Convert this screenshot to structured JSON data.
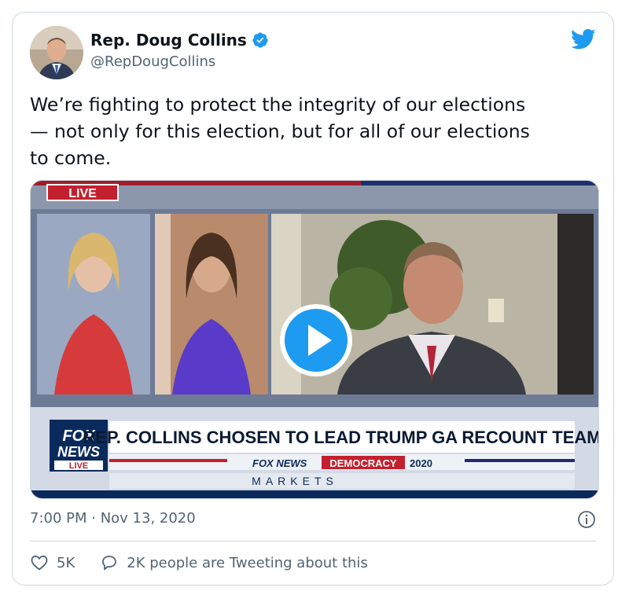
{
  "author": {
    "display_name": "Rep. Doug Collins",
    "handle": "@RepDougCollins",
    "verified": true
  },
  "tweet": {
    "text": "We’re fighting to protect the integrity of our elections\n— not only for this election, but for all of our elections\nto come."
  },
  "video": {
    "live_badge": "LIVE",
    "logo_line1": "FOX",
    "logo_line2": "NEWS",
    "logo_live": "LIVE",
    "headline": "REP. COLLINS CHOSEN TO LEAD TRUMP GA RECOUNT TEAM",
    "sub_fox": "FOX NEWS",
    "sub_democracy": "DEMOCRACY",
    "sub_year": "2020",
    "ticker": "MARKETS"
  },
  "meta": {
    "timestamp": "7:00 PM · Nov 13, 2020"
  },
  "actions": {
    "likes": "5K",
    "tweeting": "2K people are Tweeting about this"
  },
  "colors": {
    "twitter_blue": "#1d9bf0",
    "fox_red": "#c3202f",
    "fox_navy": "#0b2a5c",
    "muted": "#536471"
  }
}
